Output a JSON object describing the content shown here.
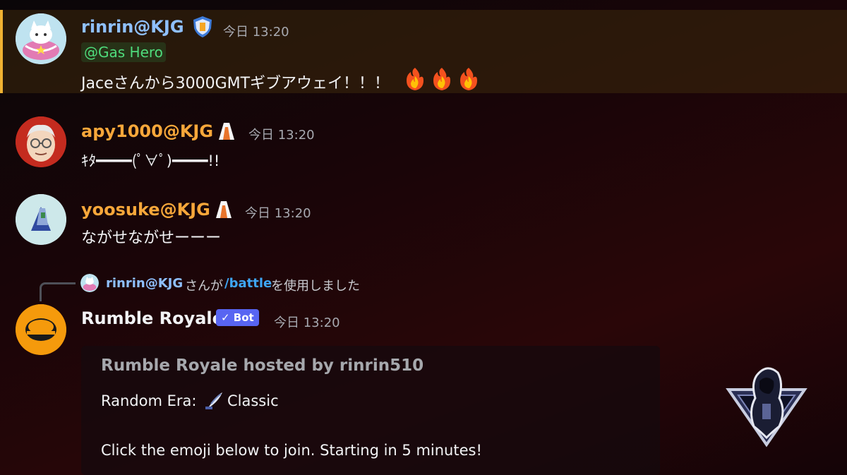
{
  "messages": [
    {
      "author": "rinrin@KJG",
      "author_color": "#8fc0ff",
      "timestamp": "今日 13:20",
      "mention": "@Gas Hero",
      "content": "Jaceさんから3000GMTギブアウェイ！！！",
      "emojis": [
        "fire-emoji",
        "fire-emoji",
        "fire-emoji"
      ]
    },
    {
      "author": "apy1000@KJG",
      "author_color": "#f7a73a",
      "timestamp": "今日 13:20",
      "content": "ｷﾀ━━━━(ﾟ∀ﾟ)━━━━!!"
    },
    {
      "author": "yoosuke@KJG",
      "author_color": "#f7a73a",
      "timestamp": "今日 13:20",
      "content": "ながせながせーーー"
    }
  ],
  "reply": {
    "user": "rinrin@KJG",
    "suffix": "さんが",
    "command": "/battle",
    "action": "を使用しました"
  },
  "bot_message": {
    "author": "Rumble Royale",
    "bot_label": "Bot",
    "timestamp": "今日 13:20",
    "embed": {
      "title": "Rumble Royale hosted by rinrin510",
      "era_label": "Random Era:",
      "era_value": "Classic",
      "join_text": "Click the emoji below to join. Starting in 5 minutes!"
    }
  },
  "colors": {
    "rinrin_name": "#8fc0ff",
    "kjg_name": "#f7a73a",
    "mention": "#4fdc7c",
    "bot_tag": "#5865f2",
    "highlight_border": "#f0b232"
  }
}
